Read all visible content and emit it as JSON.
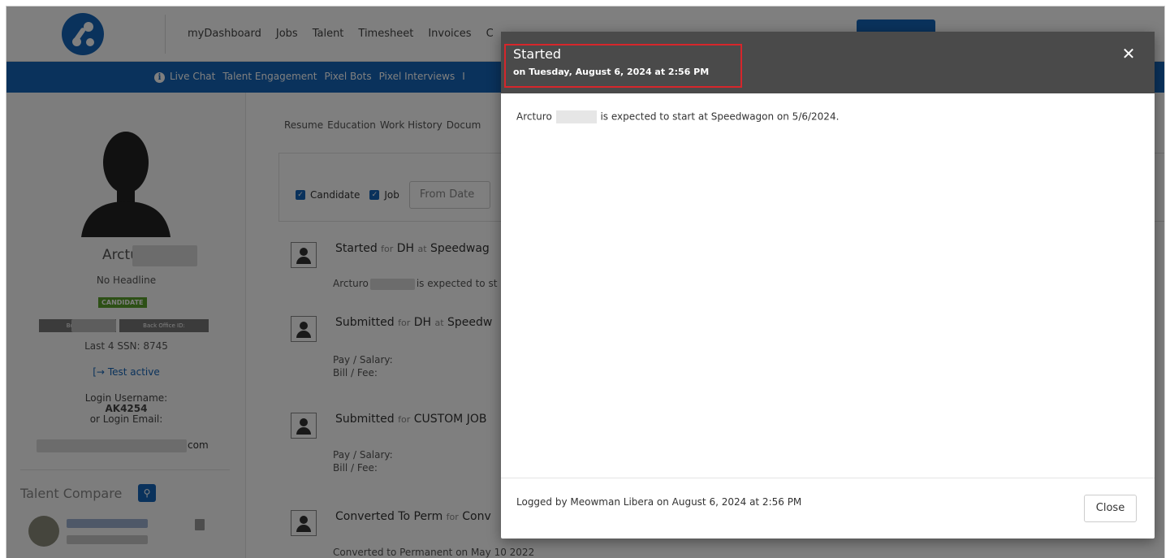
{
  "topnav": {
    "links": [
      "myDashboard",
      "Jobs",
      "Talent",
      "Timesheet",
      "Invoices",
      "C"
    ]
  },
  "subnav": {
    "items": [
      "Live Chat",
      "Talent Engagement",
      "Pixel Bots",
      "Pixel Interviews",
      "I"
    ]
  },
  "profile": {
    "first_name": "Arcturo",
    "headline": "No Headline",
    "badge": "CANDIDATE",
    "bold_id_label": "Bold ID:",
    "back_office_label": "Back Office ID:",
    "ssn": "Last 4 SSN: 8745",
    "test_active": "Test active",
    "login_username_label": "Login Username:",
    "login_username": "AK4254",
    "login_email_label": "or Login Email:",
    "email_suffix": "com",
    "talent_compare": "Talent Compare"
  },
  "content": {
    "tabs": [
      "Resume",
      "Education",
      "Work History",
      "Docum"
    ],
    "filters": {
      "candidate": "Candidate",
      "job": "Job",
      "from_date_placeholder": "From Date"
    },
    "feed": [
      {
        "title": "Started",
        "for": "for",
        "target": "DH",
        "at": "at",
        "place": "Speedwag",
        "line1": "Arcturo",
        "line1_tail": "is expected to st"
      },
      {
        "title": "Submitted",
        "for": "for",
        "target": "DH",
        "at": "at",
        "place": "Speedw",
        "line1": "Pay / Salary:",
        "line2": "Bill / Fee:"
      },
      {
        "title": "Submitted",
        "for": "for",
        "target": "CUSTOM JOB",
        "line1": "Pay / Salary:",
        "line2": "Bill / Fee:"
      },
      {
        "title": "Converted To Perm",
        "for": "for",
        "target": "Conv",
        "line1": "Converted to Permanent on May 10 2022"
      }
    ]
  },
  "modal": {
    "title": "Started",
    "subtitle": "on Tuesday, August 6, 2024 at 2:56 PM",
    "close_icon": "close-icon",
    "body_name": "Arcturo",
    "body_text": "is expected to start at Speedwagon on 5/6/2024.",
    "footer_text": "Logged by Meowman Libera on August 6, 2024 at 2:56 PM",
    "close_label": "Close",
    "highlight_color": "#d6262b"
  }
}
